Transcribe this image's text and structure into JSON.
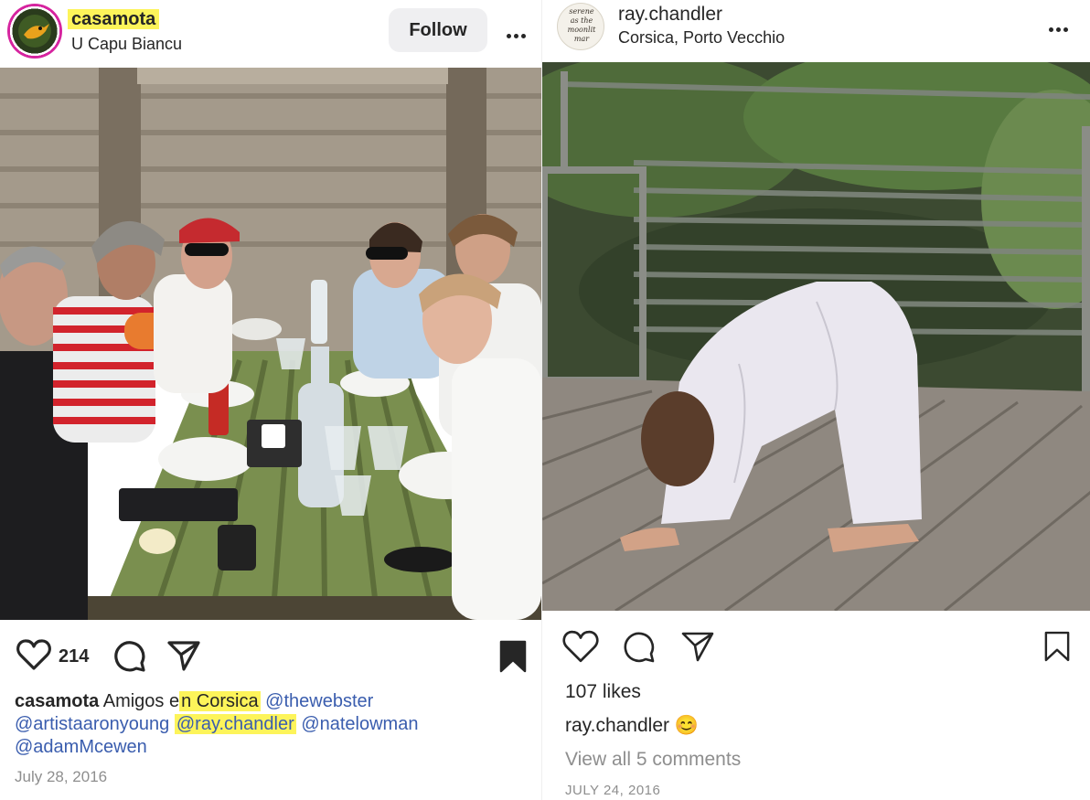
{
  "left_post": {
    "username": "casamota",
    "location": "U Capu Biancu",
    "follow_label": "Follow",
    "like_count": "214",
    "caption": {
      "author": "casamota",
      "text_before": "Amigos e",
      "text_highlight": "n Corsica",
      "mention_1": "@thewebster",
      "mention_2": "@artistaaronyoung",
      "mention_3": "@ray.chandler",
      "mention_4": "@natelowman",
      "mention_5": "@adamMcewen"
    },
    "date": "July 28, 2016"
  },
  "right_post": {
    "username": "ray.chandler",
    "location": "Corsica, Porto Vecchio",
    "likes": "107 likes",
    "caption_author": "ray.chandler",
    "caption_emoji": "😊",
    "comments_link": "View all 5 comments",
    "date": "JULY 24, 2016",
    "avatar_text": [
      "serene",
      "as the",
      "moonlit",
      "mar"
    ]
  },
  "colors": {
    "highlight": "#fdf45a",
    "mention": "#3a5dae",
    "follow_bg": "#efeff1",
    "muted": "#8e8e8e"
  },
  "icons": {
    "like": "heart-icon",
    "comment": "comment-bubble-icon",
    "share": "paper-plane-icon",
    "save": "bookmark-icon",
    "more": "more-dots-icon"
  }
}
